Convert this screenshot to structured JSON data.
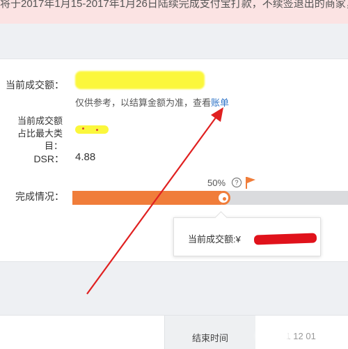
{
  "notice": {
    "text": "将于2017年1月15-2017年1月26日陆续完成支付宝打款，不续签退出的商家，"
  },
  "summary": {
    "amount_label": "当前成交额：",
    "category_label_line1": "当前成交额",
    "category_label_line2": "占比最大类目：",
    "note_prefix": "仅供参考，以结算金额为准，查看",
    "note_link": "账单",
    "dsr_label": "DSR：",
    "dsr_value": "4.88",
    "progress_label": "完成情况："
  },
  "progress": {
    "percent_text": "50%",
    "fraction": 0.54,
    "help_icon": "?",
    "flag_icon": "flag-icon",
    "tooltip_label": "当前成交额:¥"
  },
  "table_footer": {
    "end_time_label": "结束时间",
    "end_time_value": "201   12   01"
  },
  "colors": {
    "accent_orange": "#f07d3a",
    "link_blue": "#2f74c7",
    "highlight_yellow": "#fbf73c",
    "redact_red": "#e0121b",
    "arrow_red": "#e02020"
  }
}
